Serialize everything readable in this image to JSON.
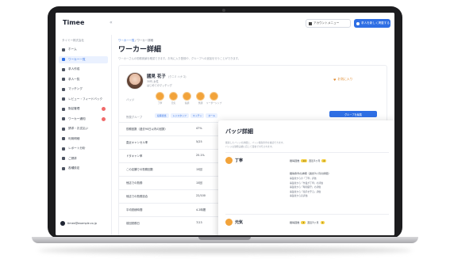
{
  "app": {
    "logo": "Timee",
    "collapse": "«",
    "top_button_1": "アカウントメニュー",
    "top_button_2": "求人を新しく掲載する",
    "org": "タイミー株式会社"
  },
  "sidebar": {
    "items": [
      {
        "label": "ホーム",
        "active": false,
        "badge": false
      },
      {
        "label": "ワーカー一覧",
        "active": true,
        "badge": false
      },
      {
        "label": "求人作成",
        "active": false,
        "badge": false
      },
      {
        "label": "求人一覧",
        "active": false,
        "badge": false
      },
      {
        "label": "マッチング",
        "active": false,
        "badge": false
      },
      {
        "label": "レビュー・フィードバック",
        "active": false,
        "badge": false
      },
      {
        "label": "勤怠管理",
        "active": false,
        "badge": true
      },
      {
        "label": "ワーカー通知",
        "active": false,
        "badge": true
      },
      {
        "label": "請求・お支払い",
        "active": false,
        "badge": false
      },
      {
        "label": "利用明細",
        "active": false,
        "badge": false
      },
      {
        "label": "レポート分析",
        "active": false,
        "badge": false
      },
      {
        "label": "ご請求",
        "active": false,
        "badge": false
      },
      {
        "label": "各種設定",
        "active": false,
        "badge": false
      }
    ],
    "footer_account": "timee@example.co.jp"
  },
  "main": {
    "breadcrumb_link": "ワーカー一覧",
    "breadcrumb_sep": "/",
    "breadcrumb_current": "ワーカー詳細",
    "title": "ワーカー詳細",
    "description": "ワーカーさんの勤務実績を確認できます。お気に入り登録や、グループへの追加を行うことができます。"
  },
  "worker": {
    "name": "國見 花子",
    "kana": "(クニミ ハナコ)",
    "sub1": "30代 女性",
    "sub2": "はじめてのマッチング",
    "favorite_label": "お気に入り",
    "badges_label": "バッジ",
    "badges": [
      {
        "label": "丁寧"
      },
      {
        "label": "元気"
      },
      {
        "label": "協調"
      },
      {
        "label": "笑顔"
      },
      {
        "label": "リーダーシップ"
      }
    ],
    "group_label": "所属グループ",
    "groups": [
      "接客担当",
      "レジスタッフ",
      "キッチン",
      "ホール"
    ],
    "group_button": "グループを編集",
    "stats": [
      {
        "key": "勤務回数（過去90日以内の回数）",
        "value": "47%"
      },
      {
        "key": "直近キャンセル率",
        "value": "5/25"
      },
      {
        "key": "ドタキャン率",
        "value": "25.1%"
      },
      {
        "key": "この店舗での勤務回数",
        "value": "15回"
      },
      {
        "key": "他店での勤務",
        "value": "15回"
      },
      {
        "key": "他店での勤務割合",
        "value": "22/100"
      },
      {
        "key": "平均勤続時間",
        "value": "4.2時間"
      },
      {
        "key": "前回勤務日",
        "value": "7/13"
      }
    ]
  },
  "badge_panel": {
    "title": "バッジ詳細",
    "note1": "獲得したバッジの詳細と、バッジ獲得条件を確認できます。",
    "note2": "バッジは勤務実績に応じて自動で付与されます。",
    "sections": [
      {
        "title": "丁寧",
        "stat_label": "獲得回数",
        "stat_value": "14",
        "stat2_label": "直近3ヶ月",
        "stat2_value": "4",
        "conditions_title": "獲得条件の詳細（過去3ヶ月の評価）",
        "conditions": [
          "事業者からの「丁寧」評価",
          "事業者から「作業が丁寧」の評価",
          "事業者から「時間厳守」の評価",
          "事業者から「指示を守る」評価",
          "事業者から高評価"
        ]
      },
      {
        "title": "元気",
        "stat_label": "獲得回数",
        "stat_value": "3",
        "stat2_label": "直近3ヶ月",
        "stat2_value": "1"
      }
    ]
  }
}
